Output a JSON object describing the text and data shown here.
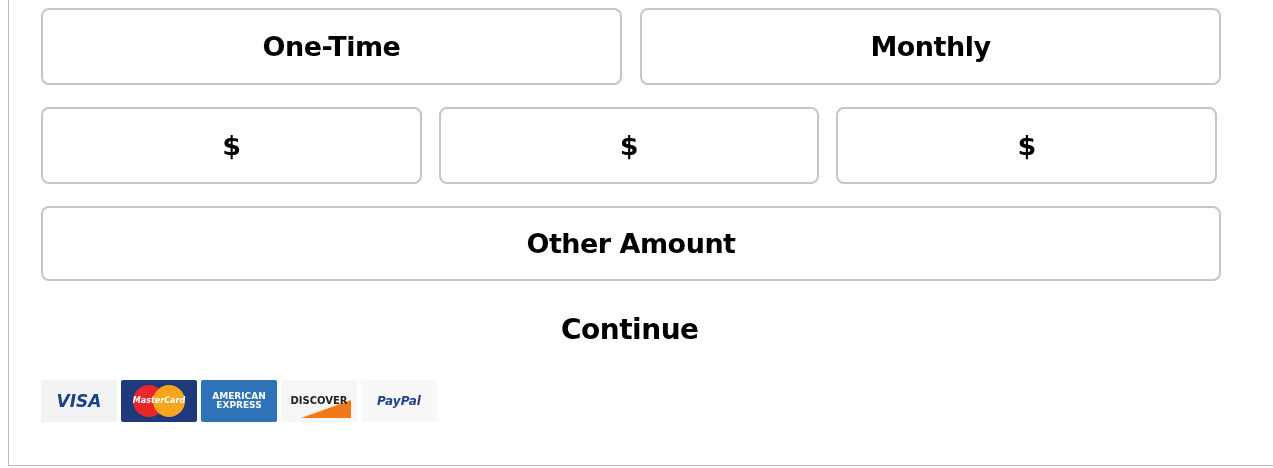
{
  "frequency_options": [
    {
      "label": "One-Time"
    },
    {
      "label": "Monthly"
    }
  ],
  "amount_options": [
    {
      "label": "$"
    },
    {
      "label": "$"
    },
    {
      "label": "$"
    }
  ],
  "other_amount": {
    "label": "Other Amount"
  },
  "continue": {
    "label": "Continue"
  },
  "payment_logos": [
    {
      "kind": "visa",
      "text": "VISA"
    },
    {
      "kind": "mastercard",
      "text": "MasterCard"
    },
    {
      "kind": "amex",
      "text": "AMERICAN EXPRESS"
    },
    {
      "kind": "discover",
      "text": "DISCOVER"
    },
    {
      "kind": "paypal",
      "text": "PayPal"
    }
  ]
}
